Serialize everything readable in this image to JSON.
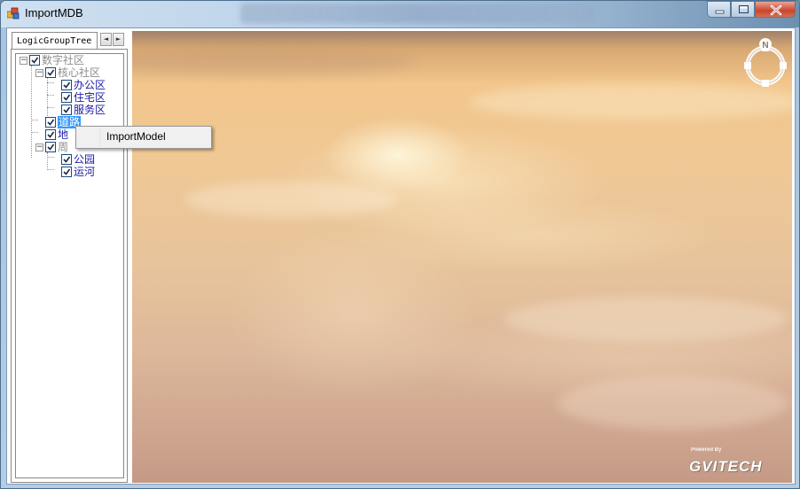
{
  "window": {
    "title": "ImportMDB",
    "icon": "app-icon",
    "controls": [
      "minimize-icon",
      "maximize-icon",
      "close-icon"
    ]
  },
  "left_panel": {
    "tab": {
      "label": "LogicGroupTree",
      "scroll_prev": "◄",
      "scroll_next": "►"
    },
    "tree": {
      "root": {
        "label": "数字社区",
        "checked": true,
        "expanded": true,
        "style": "gray"
      },
      "nodes": [
        {
          "label": "核心社区",
          "checked": true,
          "expanded": true,
          "style": "gray"
        },
        {
          "label": "办公区",
          "checked": true,
          "style": "blue"
        },
        {
          "label": "住宅区",
          "checked": true,
          "style": "blue"
        },
        {
          "label": "服务区",
          "checked": true,
          "style": "blue"
        },
        {
          "label": "道路",
          "checked": true,
          "style": "selected"
        },
        {
          "label": "地",
          "checked": true,
          "style": "blue"
        },
        {
          "label": "周",
          "checked": true,
          "expanded": true,
          "style": "gray"
        },
        {
          "label": "公园",
          "checked": true,
          "style": "blue"
        },
        {
          "label": "运河",
          "checked": true,
          "style": "blue"
        }
      ]
    }
  },
  "context_menu": {
    "items": [
      {
        "label": "ImportModel"
      }
    ]
  },
  "viewport": {
    "compass_label": "N",
    "logo_small": "Powered By",
    "logo_big": "GVITECH"
  },
  "colors": {
    "selection": "#3399ff",
    "tree_blue_text": "#1a1aa6",
    "tree_gray_text": "#8c8c8c",
    "sky_warm": "#f0c894"
  }
}
